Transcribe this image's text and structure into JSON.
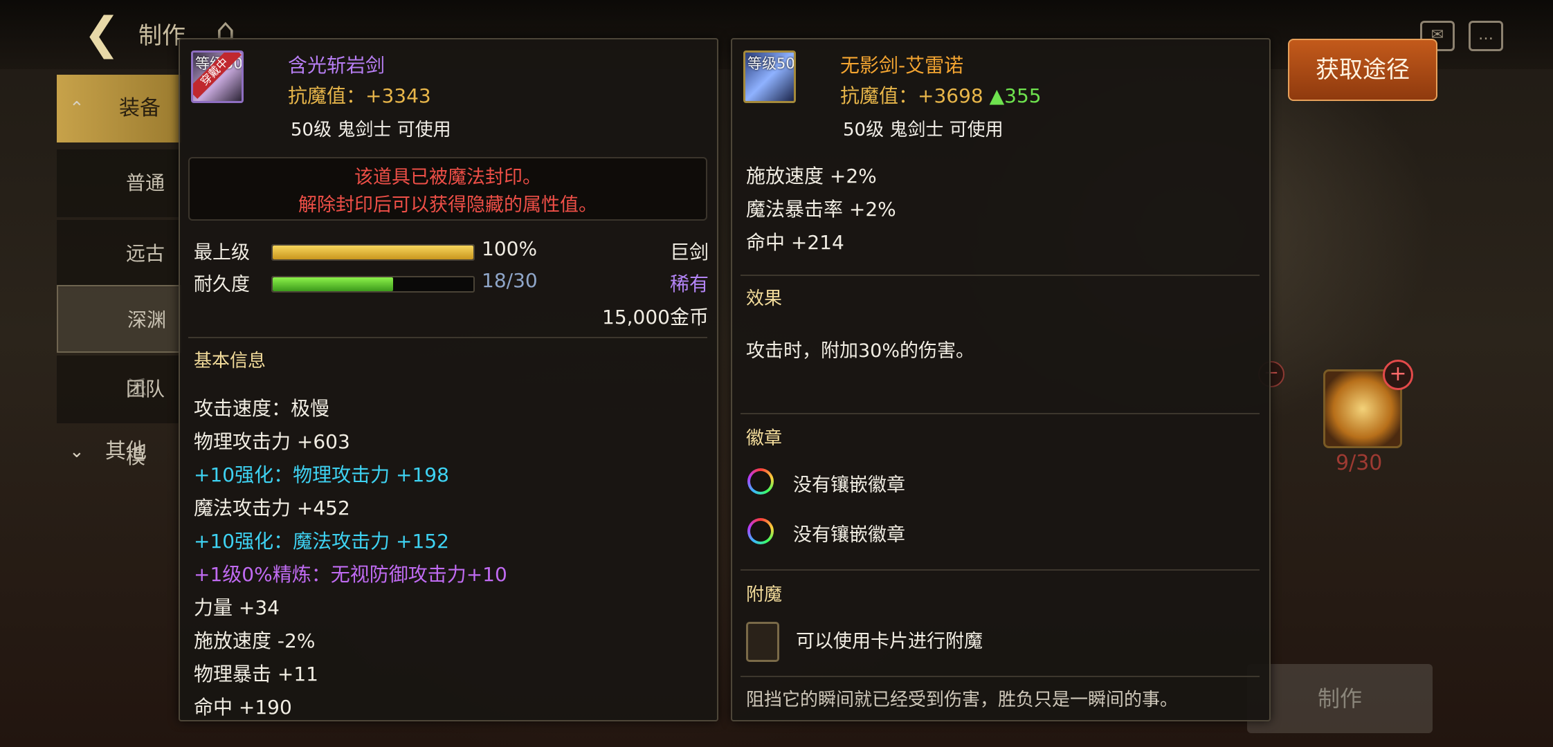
{
  "background": {
    "top_title": "制作",
    "sidebar": [
      {
        "label": "装备"
      },
      {
        "label": "普通"
      },
      {
        "label": "远古"
      },
      {
        "label": "深渊派"
      },
      {
        "label": "团队模"
      },
      {
        "label": "其他"
      }
    ],
    "get_source_label": "获取途径",
    "make_label": "制作",
    "slot_count": "9/30"
  },
  "left_item": {
    "level_badge": "等级50",
    "equipped_tag": "穿戴中",
    "name": "含光斩岩剑",
    "anti_magic": "抗魔值：+3343",
    "requirement": "50级 鬼剑士 可使用",
    "seal_line1": "该道具已被魔法封印。",
    "seal_line2": "解除封印后可以获得隐藏的属性值。",
    "grade_label": "最上级",
    "grade_value": "100%",
    "grade_percent": 100,
    "durability_label": "耐久度",
    "durability_value": "18/30",
    "durability_percent": 60,
    "weapon_type": "巨剑",
    "rarity": "稀有",
    "price": "15,000金币",
    "basic_info_title": "基本信息",
    "stats": [
      {
        "text": "攻击速度：极慢",
        "color": "white"
      },
      {
        "text": "物理攻击力 +603",
        "color": "white"
      },
      {
        "text": "+10强化：物理攻击力 +198",
        "color": "cyan"
      },
      {
        "text": "魔法攻击力 +452",
        "color": "white"
      },
      {
        "text": "+10强化：魔法攻击力 +152",
        "color": "cyan"
      },
      {
        "text": "+1级0%精炼：无视防御攻击力+10",
        "color": "purple"
      },
      {
        "text": "力量 +34",
        "color": "white"
      },
      {
        "text": "施放速度 -2%",
        "color": "white"
      },
      {
        "text": "物理暴击 +11",
        "color": "white"
      },
      {
        "text": "命中 +190",
        "color": "white"
      }
    ]
  },
  "right_item": {
    "level_badge": "等级50",
    "name": "无影剑-艾雷诺",
    "anti_magic": "抗魔值：+3698",
    "anti_magic_diff": "▲355",
    "requirement": "50级 鬼剑士 可使用",
    "stats": [
      {
        "text": "施放速度 +2%"
      },
      {
        "text": "魔法暴击率 +2%"
      },
      {
        "text": "命中 +214"
      }
    ],
    "effect_title": "效果",
    "effect_text": "攻击时，附加30%的伤害。",
    "emblem_title": "徽章",
    "emblems": [
      "没有镶嵌徽章",
      "没有镶嵌徽章"
    ],
    "enchant_title": "附魔",
    "enchant_text": "可以使用卡片进行附魔",
    "flavor_text": "阻挡它的瞬间就已经受到伤害，胜负只是一瞬间的事。"
  },
  "colors": {
    "gold": "#e8b64a",
    "cyan": "#3ed2f2",
    "purple": "#c06bf2",
    "seal_red": "#ee4f47",
    "diff_green": "#6ee24e"
  }
}
